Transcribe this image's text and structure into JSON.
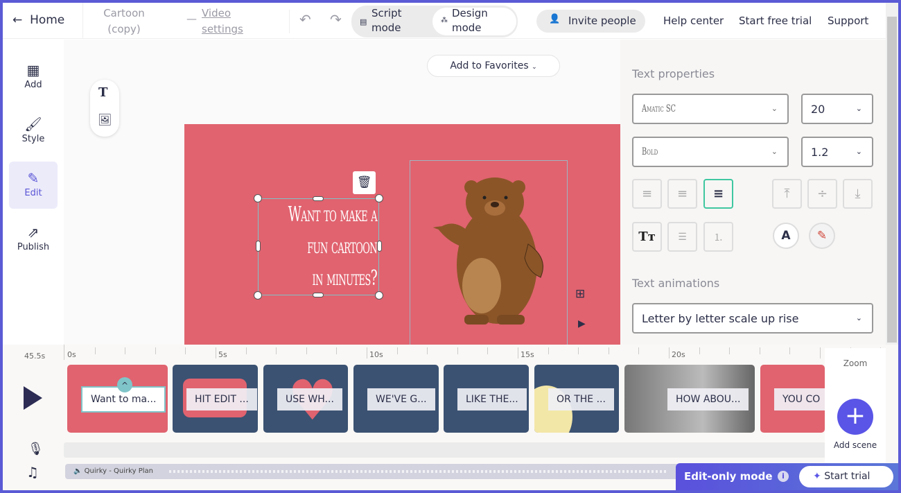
{
  "topbar": {
    "home": "Home",
    "project_title": "Cartoon (copy)",
    "video_settings": "Video settings",
    "script_mode": "Script mode",
    "design_mode": "Design mode",
    "invite": "Invite people",
    "help": "Help center",
    "trial": "Start free trial",
    "support": "Support"
  },
  "sidebar": {
    "items": [
      {
        "label": "Add",
        "icon": "grid-icon"
      },
      {
        "label": "Style",
        "icon": "brush-icon"
      },
      {
        "label": "Edit",
        "icon": "pencil-icon",
        "active": true
      },
      {
        "label": "Publish",
        "icon": "share-icon"
      }
    ]
  },
  "stage": {
    "favorites": "Add to Favorites",
    "text_lines": [
      "Want to make a",
      "fun cartoon",
      "in minutes?"
    ]
  },
  "panel": {
    "text_properties": "Text properties",
    "font": "Amatic SC",
    "size": "20",
    "weight": "Bold",
    "line_height": "1.2",
    "text_animations": "Text animations",
    "animation": "Letter by letter scale up rise",
    "alignment": "right",
    "accent": "#3fc7a0"
  },
  "timeline": {
    "duration": "45.5s",
    "ticks": [
      "0s",
      "5s",
      "10s",
      "15s",
      "20s"
    ],
    "zoom": "Zoom",
    "add_scene": "Add scene",
    "audio": "Quirky - Quirky Plan",
    "scenes": [
      {
        "label": "Want to ma...",
        "bg": "#e0636f"
      },
      {
        "label": "HIT EDIT ...",
        "bg": "#3b5272"
      },
      {
        "label": "USE WH...",
        "bg": "#3b5272"
      },
      {
        "label": "WE'VE G...",
        "bg": "#3b5272"
      },
      {
        "label": "LIKE THE...",
        "bg": "#3b5272"
      },
      {
        "label": "OR THE ...",
        "bg": "#3b5272"
      },
      {
        "label": "HOW ABOU...",
        "bg": "#8e8e8e"
      },
      {
        "label": "YOU CO",
        "bg": "#e0636f"
      }
    ]
  },
  "footer": {
    "edit_only": "Edit-only mode",
    "start_trial": "Start trial"
  }
}
